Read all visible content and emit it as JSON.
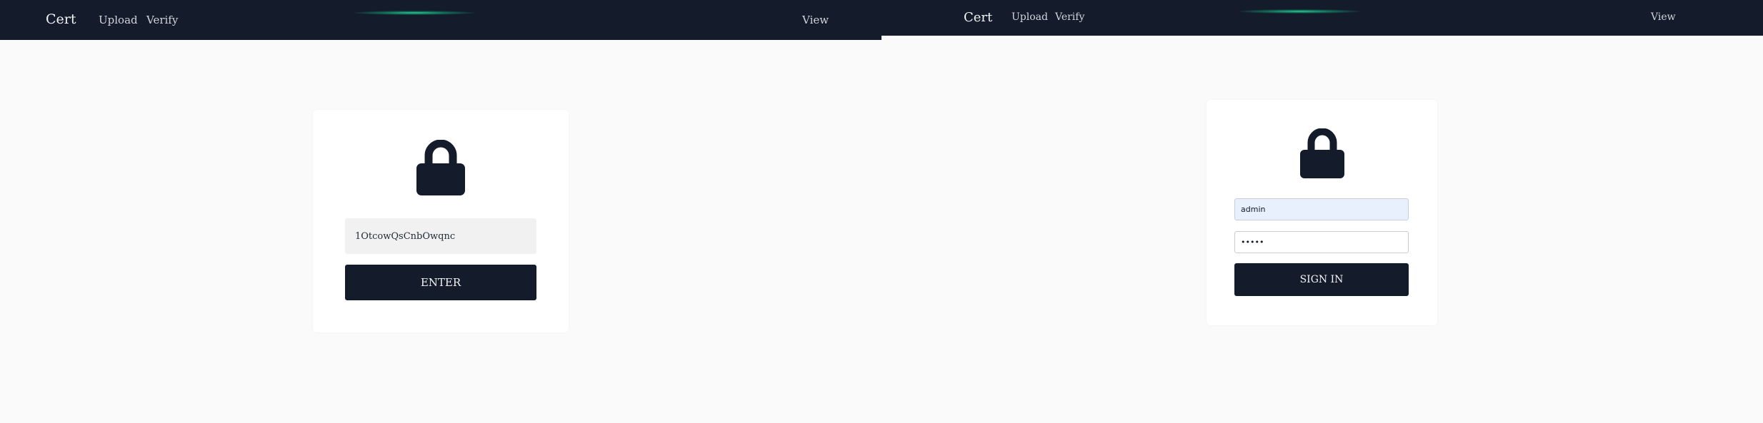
{
  "left": {
    "navbar": {
      "brand": "Cert",
      "links": {
        "upload": "Upload",
        "verify": "Verify",
        "view": "View"
      }
    },
    "form": {
      "code_value": "1OtcowQsCnbOwqnc",
      "enter_label": "ENTER"
    }
  },
  "right": {
    "navbar": {
      "brand": "Cert",
      "links": {
        "upload": "Upload",
        "verify": "Verify",
        "view": "View"
      }
    },
    "form": {
      "username_value": "admin",
      "password_value": "•••••",
      "sign_in_label": "SIGN IN"
    }
  },
  "colors": {
    "navbar_bg": "#141b2b",
    "page_bg": "#fafafa",
    "accent_glow": "#34d399",
    "button_bg": "#141b2b",
    "autofill_bg": "#e8f0fe"
  },
  "icons": {
    "lock": "lock-icon",
    "glow": "glow-decoration"
  }
}
